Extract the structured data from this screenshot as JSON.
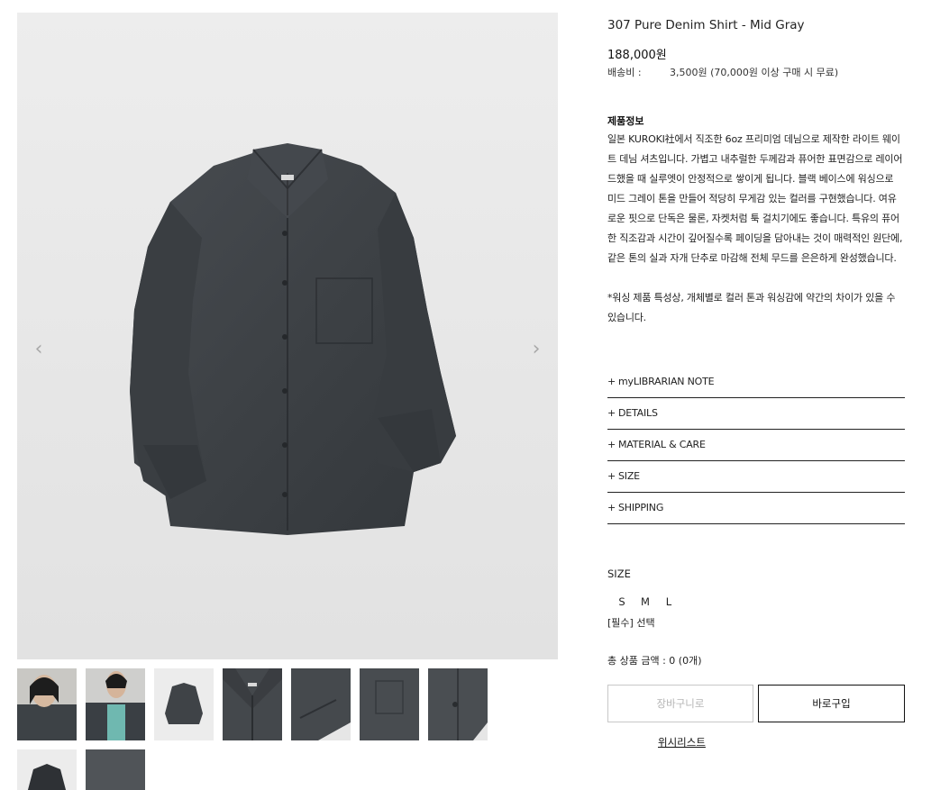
{
  "product": {
    "title": "307 Pure Denim Shirt - Mid Gray",
    "price": "188,000원",
    "shipping_label": "배송비 :",
    "shipping_value": "3,500원 (70,000원 이상 구매 시 무료)"
  },
  "description": {
    "heading": "제품정보",
    "paragraph1": "일본 KUROKI社에서 직조한 6oz 프리미엄 데님으로 제작한 라이트 웨이트 데님 셔츠입니다. 가볍고 내추럴한 두께감과 퓨어한 표면감으로 레이어드했을 때 실루엣이 안정적으로 쌓이게 됩니다. 블랙 베이스에 워싱으로 미드 그레이 톤을 만들어 적당히 무게감 있는 컬러를 구현했습니다. 여유로운 핏으로 단독은 물론, 자켓처럼 툭 걸치기에도 좋습니다. 특유의 퓨어한 직조감과 시간이 깊어질수록 페이딩을 담아내는 것이 매력적인 원단에, 같은 톤의 실과 자개 단추로 마감해 전체 무드를 은은하게 완성했습니다.",
    "paragraph2": "*워싱 제품 특성상, 개체별로 컬러 톤과 워싱감에 약간의 차이가 있을 수 있습니다."
  },
  "accordion": [
    {
      "label": "myLIBRARIAN NOTE"
    },
    {
      "label": "DETAILS"
    },
    {
      "label": "MATERIAL & CARE"
    },
    {
      "label": "SIZE"
    },
    {
      "label": "SHIPPING"
    }
  ],
  "accordion_plus": "+",
  "size": {
    "label": "SIZE",
    "options": [
      "S",
      "M",
      "L"
    ],
    "required_text": "[필수] 선택"
  },
  "total_text": "총 상품 금액 : 0 (0개)",
  "buttons": {
    "cart": "장바구니로",
    "buy": "바로구입",
    "wishlist": "위시리스트"
  },
  "gallery": {
    "prev_icon": "chevron-left-icon",
    "next_icon": "chevron-right-icon",
    "thumbnail_count": 9,
    "colors": {
      "shirt": "#3e4246",
      "shirt_dark": "#2f3236",
      "background": "#e8e8e8"
    }
  }
}
